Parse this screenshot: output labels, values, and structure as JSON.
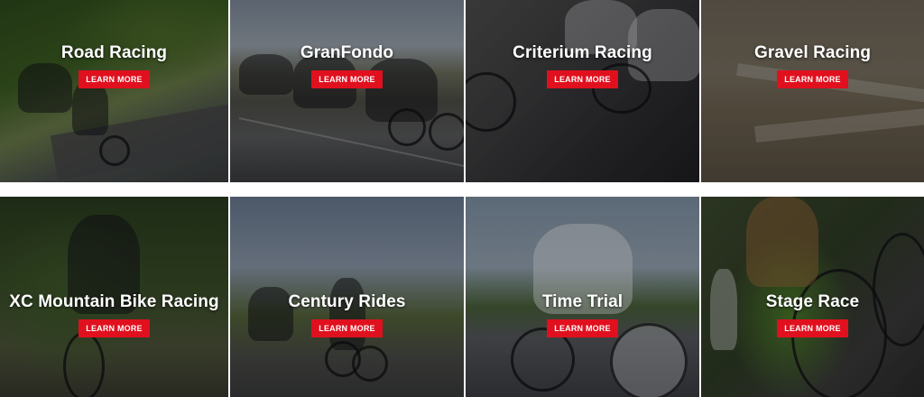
{
  "tiles": [
    {
      "title": "Road Racing",
      "button": "LEARN MORE"
    },
    {
      "title": "GranFondo",
      "button": "LEARN MORE"
    },
    {
      "title": "Criterium Racing",
      "button": "LEARN MORE"
    },
    {
      "title": "Gravel Racing",
      "button": "LEARN MORE"
    },
    {
      "title": "XC Mountain Bike Racing",
      "button": "LEARN MORE"
    },
    {
      "title": "Century Rides",
      "button": "LEARN MORE"
    },
    {
      "title": "Time Trial",
      "button": "LEARN MORE"
    },
    {
      "title": "Stage Race",
      "button": "LEARN MORE"
    }
  ],
  "colors": {
    "button_bg": "#e0101e",
    "title_text": "#ffffff",
    "page_bg": "#ffffff"
  }
}
